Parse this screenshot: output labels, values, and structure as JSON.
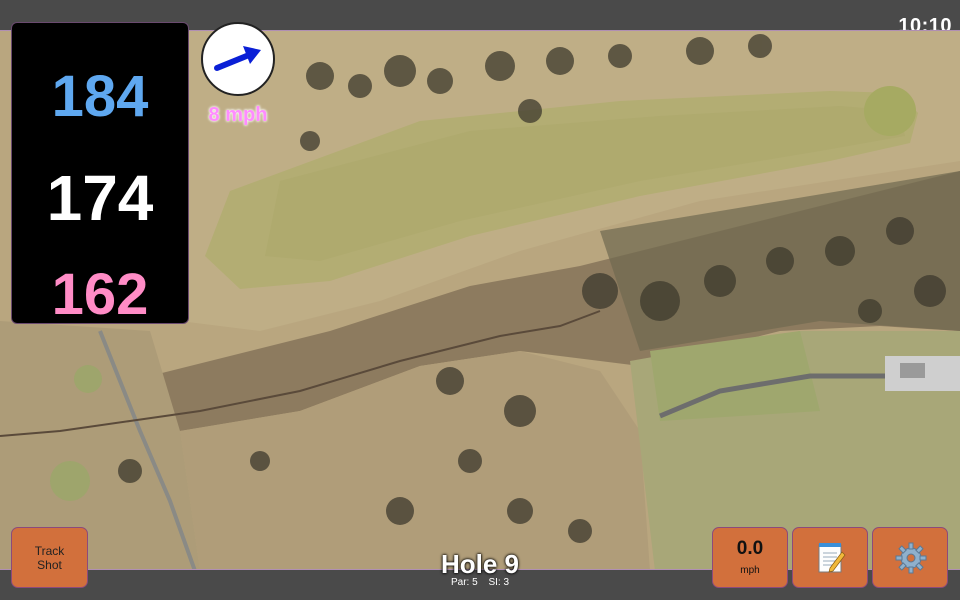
{
  "status": {
    "time": "10:10"
  },
  "distances": {
    "back": "184",
    "middle": "174",
    "front": "162"
  },
  "wind": {
    "label": "8 mph",
    "direction_icon": "arrow-northeast"
  },
  "buttons": {
    "track_shot_line1": "Track",
    "track_shot_line2": "Shot",
    "speed_value": "0.0",
    "speed_unit": "mph",
    "notes_icon": "notepad-icon",
    "settings_icon": "gear-icon"
  },
  "hole": {
    "title": "Hole 9",
    "par_label": "Par: 5",
    "si_label": "SI: 3"
  },
  "colors": {
    "back_distance": "#5fa8f0",
    "middle_distance": "#ffffff",
    "front_distance": "#ff8cc6",
    "button_bg": "#d2703c",
    "wind_label": "#ff8cff"
  }
}
